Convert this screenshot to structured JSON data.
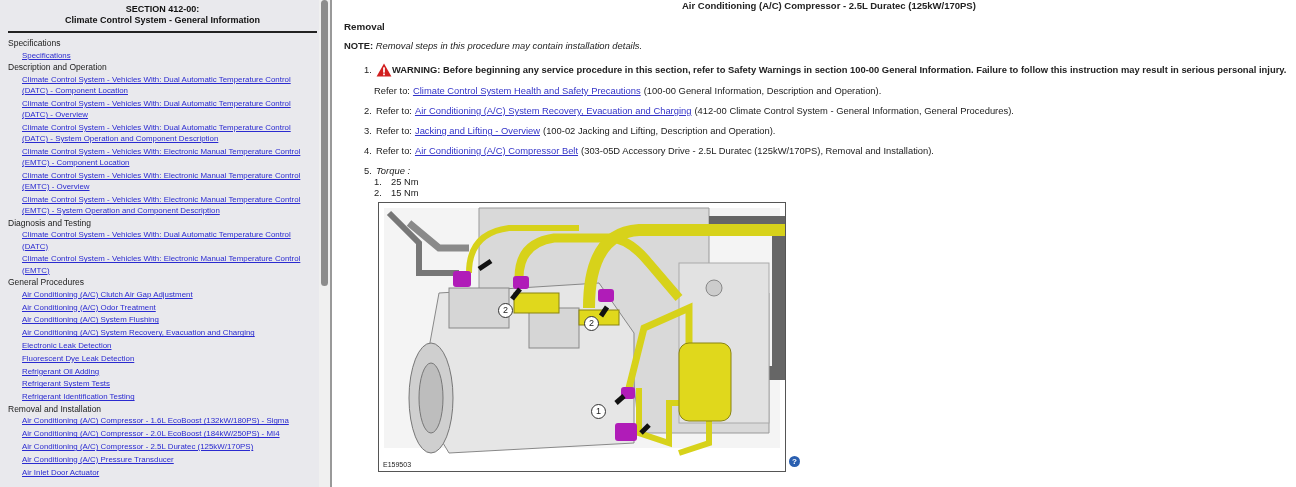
{
  "sidebar": {
    "section": "SECTION 412-00:",
    "title": "Climate Control System - General Information",
    "groups": [
      {
        "heading": "Specifications",
        "links": [
          "Specifications"
        ]
      },
      {
        "heading": "Description and Operation",
        "links": [
          "Climate Control System - Vehicles With: Dual Automatic Temperature Control (DATC) - Component Location",
          "Climate Control System - Vehicles With: Dual Automatic Temperature Control (DATC) - Overview",
          "Climate Control System - Vehicles With: Dual Automatic Temperature Control (DATC) - System Operation and Component Description",
          "Climate Control System - Vehicles With: Electronic Manual Temperature Control (EMTC) - Component Location",
          "Climate Control System - Vehicles With: Electronic Manual Temperature Control (EMTC) - Overview",
          "Climate Control System - Vehicles With: Electronic Manual Temperature Control (EMTC) - System Operation and Component Description"
        ]
      },
      {
        "heading": "Diagnosis and Testing",
        "links": [
          "Climate Control System - Vehicles With: Dual Automatic Temperature Control (DATC)",
          "Climate Control System - Vehicles With: Electronic Manual Temperature Control (EMTC)"
        ]
      },
      {
        "heading": "General Procedures",
        "links": [
          "Air Conditioning (A/C) Clutch Air Gap Adjustment",
          "Air Conditioning (A/C) Odor Treatment",
          "Air Conditioning (A/C) System Flushing",
          "Air Conditioning (A/C) System Recovery, Evacuation and Charging",
          "Electronic Leak Detection",
          "Fluorescent Dye Leak Detection",
          "Refrigerant Oil Adding",
          "Refrigerant System Tests",
          "Refrigerant Identification Testing"
        ]
      },
      {
        "heading": "Removal and Installation",
        "links": [
          "Air Conditioning (A/C) Compressor - 1.6L EcoBoost (132kW/180PS) - Sigma",
          "Air Conditioning (A/C) Compressor - 2.0L EcoBoost (184kW/250PS) - MI4",
          "Air Conditioning (A/C) Compressor - 2.5L Duratec (125kW/170PS)",
          "Air Conditioning (A/C) Pressure Transducer",
          "Air Inlet Door Actuator"
        ]
      }
    ]
  },
  "main": {
    "title": "Air Conditioning (A/C) Compressor - 2.5L Duratec (125kW/170PS)",
    "heading": "Removal",
    "note": {
      "label": "NOTE:",
      "text": "Removal steps in this procedure may contain installation details."
    },
    "steps": [
      {
        "kind": "warning",
        "number": "1.",
        "warning": "WARNING: Before beginning any service procedure in this section, refer to Safety Warnings in section 100-00 General Information. Failure to follow this instruction may result in serious personal injury.",
        "refer": "Refer to:",
        "link": "Climate Control System Health and Safety Precautions",
        "suffix": "(100-00 General Information, Description and Operation)."
      },
      {
        "kind": "refer",
        "number": "2.",
        "refer": "Refer to:",
        "link": "Air Conditioning (A/C) System Recovery, Evacuation and Charging",
        "suffix": "(412-00 Climate Control System - General Information, General Procedures)."
      },
      {
        "kind": "refer",
        "number": "3.",
        "refer": "Refer to:",
        "link": "Jacking and Lifting - Overview",
        "suffix": "(100-02 Jacking and Lifting, Description and Operation)."
      },
      {
        "kind": "refer",
        "number": "4.",
        "refer": "Refer to:",
        "link": "Air Conditioning (A/C) Compressor Belt",
        "suffix": "(303-05D Accessory Drive - 2.5L Duratec (125kW/170PS), Removal and Installation)."
      },
      {
        "kind": "torque",
        "number": "5.",
        "label": "Torque :",
        "items": [
          {
            "number": "1.",
            "value": "25 Nm"
          },
          {
            "number": "2.",
            "value": "15 Nm"
          }
        ]
      }
    ],
    "figure": {
      "code": "E159503",
      "callouts": [
        "2",
        "2",
        "1"
      ],
      "help": "?"
    }
  }
}
